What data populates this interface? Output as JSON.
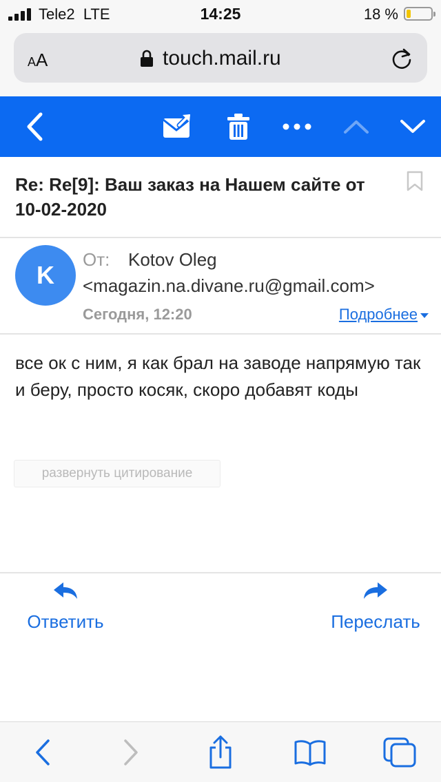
{
  "status_bar": {
    "carrier": "Tele2",
    "network": "LTE",
    "time": "14:25",
    "battery_percent": "18 %",
    "battery_level": 0.18
  },
  "browser": {
    "text_size_label": "AA",
    "url": "touch.mail.ru"
  },
  "toolbar": {
    "icons": [
      "back-icon",
      "move-to-folder-icon",
      "trash-icon",
      "more-icon",
      "previous-icon",
      "next-icon"
    ]
  },
  "email": {
    "subject": "Re: Re[9]: Ваш заказ на Нашем сайте от 10-02-2020",
    "avatar_letter": "K",
    "from_label": "От:",
    "sender_name": "Kotov Oleg",
    "sender_email": "<magazin.na.divane.ru@gmail.com>",
    "date": "Сегодня, 12:20",
    "details_link": "Подробнее",
    "body": "все ок с ним, я как брал на заводе напрямую так и беру, просто косяк, скоро добавят коды",
    "expand_quote": "развернуть цитирование"
  },
  "actions": {
    "reply": "Ответить",
    "forward": "Переслать"
  },
  "colors": {
    "accent": "#0c6af2",
    "link": "#1a6ee0",
    "avatar": "#3d8bf0"
  }
}
